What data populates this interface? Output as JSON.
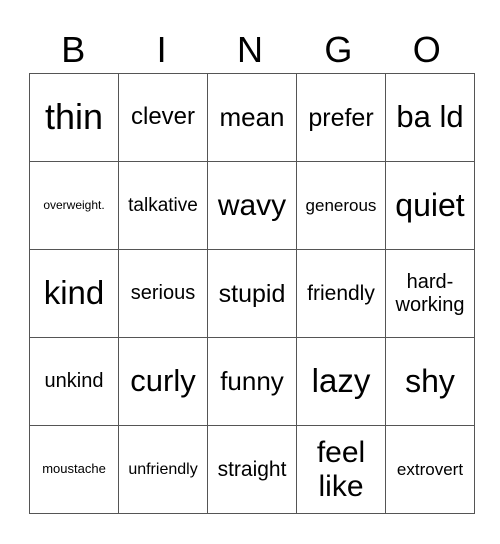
{
  "header": [
    "B",
    "I",
    "N",
    "G",
    "O"
  ],
  "rows": [
    [
      {
        "text": "thin",
        "size": 36
      },
      {
        "text": "clever",
        "size": 24
      },
      {
        "text": "mean",
        "size": 26
      },
      {
        "text": "prefer",
        "size": 25
      },
      {
        "text": "ba ld",
        "size": 31
      }
    ],
    [
      {
        "text": "overweight.",
        "size": 12
      },
      {
        "text": "talkative",
        "size": 19
      },
      {
        "text": "wavy",
        "size": 30
      },
      {
        "text": "generous",
        "size": 17
      },
      {
        "text": "quiet",
        "size": 32
      }
    ],
    [
      {
        "text": "kind",
        "size": 33
      },
      {
        "text": "serious",
        "size": 20
      },
      {
        "text": "stupid",
        "size": 25
      },
      {
        "text": "friendly",
        "size": 21
      },
      {
        "text": "hard- working",
        "size": 20
      }
    ],
    [
      {
        "text": "unkind",
        "size": 20
      },
      {
        "text": "curly",
        "size": 31
      },
      {
        "text": "funny",
        "size": 26
      },
      {
        "text": "lazy",
        "size": 33
      },
      {
        "text": "shy",
        "size": 32
      }
    ],
    [
      {
        "text": "moustache",
        "size": 13
      },
      {
        "text": "unfriendly",
        "size": 16
      },
      {
        "text": "straight",
        "size": 21
      },
      {
        "text": "feel like",
        "size": 30
      },
      {
        "text": "extrovert",
        "size": 17
      }
    ]
  ]
}
